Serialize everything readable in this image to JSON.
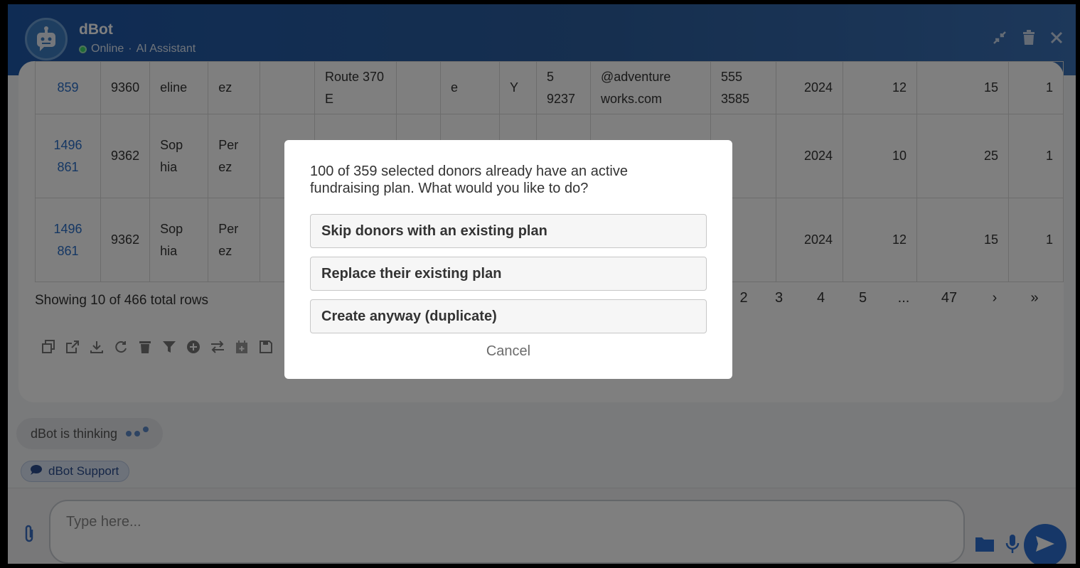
{
  "header": {
    "title": "dBot",
    "status": "Online",
    "separator": "·",
    "subtitle": "AI Assistant"
  },
  "icons": {
    "bot": "robot-icon",
    "minimize": "compress-icon",
    "trash": "trash-icon",
    "close": "close-icon"
  },
  "table": {
    "rows": [
      [
        "859",
        "9360",
        "eline",
        "ez",
        "",
        "Route 370 E",
        "",
        "e",
        "Y",
        "5 9237",
        "@adventure works.com",
        "555 3585",
        "2024",
        "12",
        "15",
        "1"
      ],
      [
        "1496 861",
        "9362",
        "Sop hia",
        "Per ez",
        "",
        "",
        "",
        "",
        "",
        "",
        "",
        "",
        "2024",
        "10",
        "25",
        "1"
      ],
      [
        "1496 861",
        "9362",
        "Sop hia",
        "Per ez",
        "",
        "",
        "",
        "",
        "",
        "",
        "",
        "",
        "2024",
        "12",
        "15",
        "1"
      ]
    ]
  },
  "footer": {
    "showing": "Showing 10 of 466 total rows"
  },
  "pager": [
    "2",
    "3",
    "4",
    "5",
    "...",
    "47",
    "›",
    "»"
  ],
  "thinking": {
    "label": "dBot is thinking"
  },
  "support": {
    "label": "dBot Support"
  },
  "input": {
    "placeholder": "Type here..."
  },
  "dialog": {
    "message": "100 of 359 selected donors already have an active fundraising plan. What would you like to do?",
    "options": [
      "Skip donors with an existing plan",
      "Replace their existing plan",
      "Create anyway (duplicate)"
    ],
    "cancel": "Cancel"
  },
  "colors": {
    "header": "#1f58a8",
    "accent": "#2c6fd1",
    "link": "#2a6fc9"
  }
}
